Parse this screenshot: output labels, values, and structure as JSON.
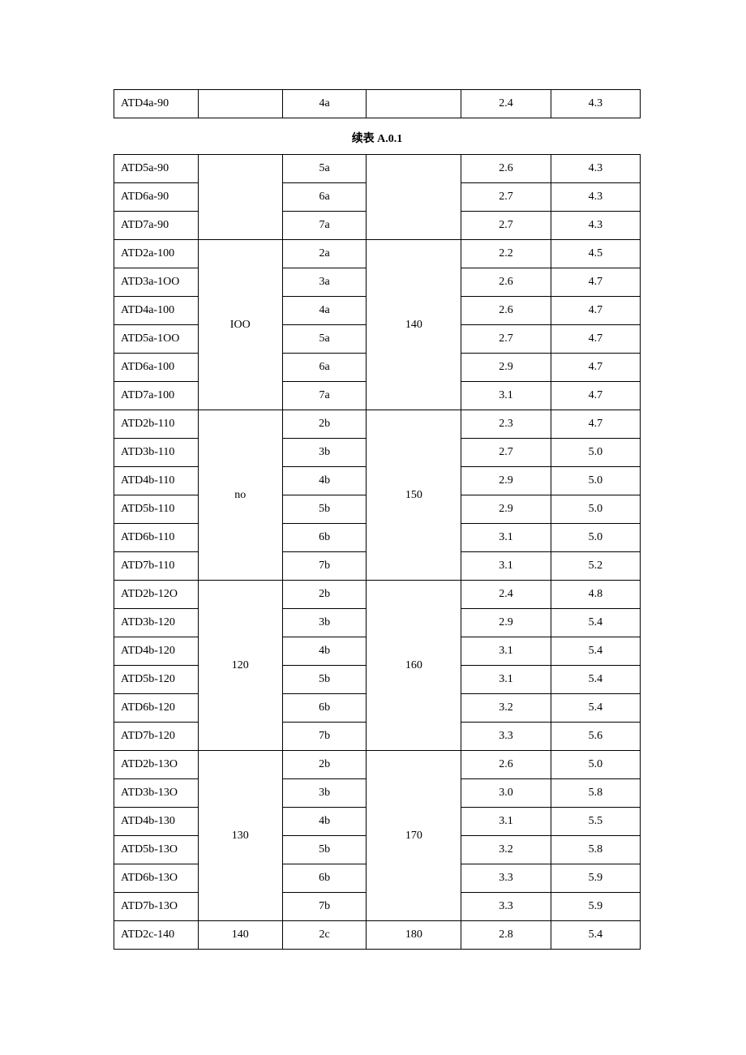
{
  "caption": "续表 A.0.1",
  "table1_rows": [
    {
      "c1": "ATD4a-90",
      "c2": "",
      "c3": "4a",
      "c4": "",
      "c5": "2.4",
      "c6": "4.3"
    }
  ],
  "groups": [
    {
      "c2": "",
      "c4": "",
      "rows": [
        {
          "c1": "ATD5a-90",
          "c3": "5a",
          "c5": "2.6",
          "c6": "4.3"
        },
        {
          "c1": "ATD6a-90",
          "c3": "6a",
          "c5": "2.7",
          "c6": "4.3"
        },
        {
          "c1": "ATD7a-90",
          "c3": "7a",
          "c5": "2.7",
          "c6": "4.3"
        }
      ]
    },
    {
      "c2": "IOO",
      "c4": "140",
      "rows": [
        {
          "c1": "ATD2a-100",
          "c3": "2a",
          "c5": "2.2",
          "c6": "4.5"
        },
        {
          "c1": "ATD3a-1OO",
          "c3": "3a",
          "c5": "2.6",
          "c6": "4.7"
        },
        {
          "c1": "ATD4a-100",
          "c3": "4a",
          "c5": "2.6",
          "c6": "4.7"
        },
        {
          "c1": "ATD5a-1OO",
          "c3": "5a",
          "c5": "2.7",
          "c6": "4.7"
        },
        {
          "c1": "ATD6a-100",
          "c3": "6a",
          "c5": "2.9",
          "c6": "4.7"
        },
        {
          "c1": "ATD7a-100",
          "c3": "7a",
          "c5": "3.1",
          "c6": "4.7"
        }
      ]
    },
    {
      "c2": "no",
      "c4": "150",
      "rows": [
        {
          "c1": "ATD2b-110",
          "c3": "2b",
          "c5": "2.3",
          "c6": "4.7"
        },
        {
          "c1": "ATD3b-110",
          "c3": "3b",
          "c5": "2.7",
          "c6": "5.0"
        },
        {
          "c1": "ATD4b-110",
          "c3": "4b",
          "c5": "2.9",
          "c6": "5.0"
        },
        {
          "c1": "ATD5b-110",
          "c3": "5b",
          "c5": "2.9",
          "c6": "5.0"
        },
        {
          "c1": "ATD6b-110",
          "c3": "6b",
          "c5": "3.1",
          "c6": "5.0"
        },
        {
          "c1": "ATD7b-110",
          "c3": "7b",
          "c5": "3.1",
          "c6": "5.2"
        }
      ]
    },
    {
      "c2": "120",
      "c4": "160",
      "rows": [
        {
          "c1": "ATD2b-12O",
          "c3": "2b",
          "c5": "2.4",
          "c6": "4.8"
        },
        {
          "c1": "ATD3b-120",
          "c3": "3b",
          "c5": "2.9",
          "c6": "5.4"
        },
        {
          "c1": "ATD4b-120",
          "c3": "4b",
          "c5": "3.1",
          "c6": "5.4"
        },
        {
          "c1": "ATD5b-120",
          "c3": "5b",
          "c5": "3.1",
          "c6": "5.4"
        },
        {
          "c1": "ATD6b-120",
          "c3": "6b",
          "c5": "3.2",
          "c6": "5.4"
        },
        {
          "c1": "ATD7b-120",
          "c3": "7b",
          "c5": "3.3",
          "c6": "5.6"
        }
      ]
    },
    {
      "c2": "130",
      "c4": "170",
      "rows": [
        {
          "c1": "ATD2b-13O",
          "c3": "2b",
          "c5": "2.6",
          "c6": "5.0"
        },
        {
          "c1": "ATD3b-13O",
          "c3": "3b",
          "c5": "3.0",
          "c6": "5.8"
        },
        {
          "c1": "ATD4b-130",
          "c3": "4b",
          "c5": "3.1",
          "c6": "5.5"
        },
        {
          "c1": "ATD5b-13O",
          "c3": "5b",
          "c5": "3.2",
          "c6": "5.8"
        },
        {
          "c1": "ATD6b-13O",
          "c3": "6b",
          "c5": "3.3",
          "c6": "5.9"
        },
        {
          "c1": "ATD7b-13O",
          "c3": "7b",
          "c5": "3.3",
          "c6": "5.9"
        }
      ]
    },
    {
      "c2": "140",
      "c4": "180",
      "rows": [
        {
          "c1": "ATD2c-140",
          "c3": "2c",
          "c5": "2.8",
          "c6": "5.4"
        }
      ]
    }
  ]
}
